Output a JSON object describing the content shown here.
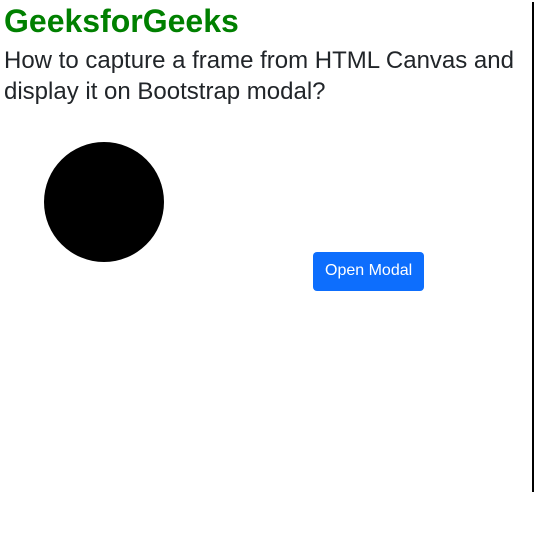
{
  "header": {
    "title": "GeeksforGeeks",
    "subtitle": "How to capture a frame from HTML Canvas and display it on Bootstrap modal?"
  },
  "canvas": {
    "shape": "circle",
    "fill": "#000000"
  },
  "buttons": {
    "open_modal_label": "Open Modal"
  },
  "colors": {
    "brand_green": "#008000",
    "primary": "#0d6efd",
    "text": "#212529"
  }
}
